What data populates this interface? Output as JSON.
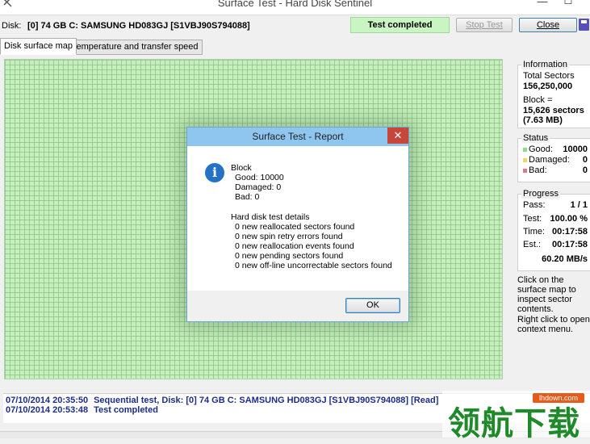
{
  "window": {
    "title": "Surface Test - Hard Disk Sentinel",
    "min_glyph": "—",
    "max_glyph": "☐"
  },
  "toolbar": {
    "disk_label": "Disk:",
    "disk_value": "[0] 74 GB C: SAMSUNG HD083GJ [S1VBJ90S794088]",
    "status": "Test completed",
    "stop_label": "Stop Test",
    "close_label": "Close"
  },
  "tabs": [
    {
      "label": "Disk surface map",
      "active": true
    },
    {
      "label": "Temperature and transfer speed",
      "active": false
    }
  ],
  "information": {
    "title": "Information",
    "total_sectors_label": "Total Sectors",
    "total_sectors_value": "156,250,000",
    "block_label": "Block =",
    "block_sectors": "15,626 sectors",
    "block_size": "(7.63 MB)"
  },
  "status_panel": {
    "title": "Status",
    "good_label": "Good:",
    "good_value": "10000",
    "damaged_label": "Damaged:",
    "damaged_value": "0",
    "bad_label": "Bad:",
    "bad_value": "0"
  },
  "progress": {
    "title": "Progress",
    "pass_label": "Pass:",
    "pass_value": "1 / 1",
    "test_label": "Test:",
    "test_value": "100.00 %",
    "time_label": "Time:",
    "time_value": "00:17:58",
    "est_label": "Est.:",
    "est_value": "00:17:58",
    "speed": "60.20 MB/s"
  },
  "help": {
    "click": "Click on the surface map to inspect sector contents.",
    "right_click": "Right click to open context menu."
  },
  "log": [
    {
      "time": "07/10/2014  20:35:50",
      "text": "Sequential test, Disk: [0] 74 GB C: SAMSUNG HD083GJ [S1VBJ90S794088] [Read]"
    },
    {
      "time": "07/10/2014  20:53:48",
      "text": "Test completed"
    }
  ],
  "dialog": {
    "title": "Surface Test - Report",
    "close_glyph": "✕",
    "block_heading": "Block",
    "good": "Good: 10000",
    "damaged": "Damaged: 0",
    "bad": "Bad: 0",
    "details_heading": "Hard disk test details",
    "details": [
      "0 new reallocated sectors found",
      "0 new spin retry errors found",
      "0 new reallocation events found",
      "0 new pending sectors found",
      "0 new off-line uncorrectable sectors found"
    ],
    "ok_label": "OK"
  },
  "watermark": {
    "text": "领航下载",
    "badge": "lhdown.com"
  },
  "colors": {
    "map_good": "#c6efbd",
    "status_good": "#c8f5c2",
    "dialog_title": "#8ec6ef",
    "dialog_close": "#c7463b"
  }
}
